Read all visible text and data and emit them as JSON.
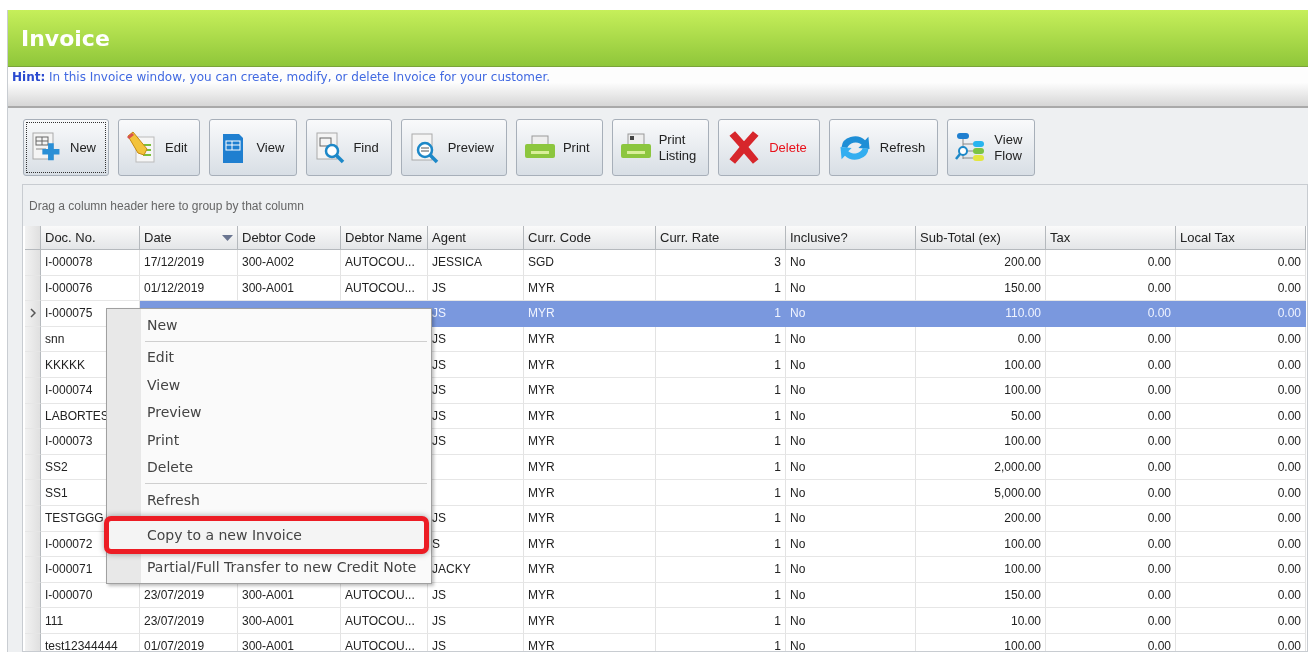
{
  "window": {
    "title": "Invoice"
  },
  "hint": "**Hint:** In this Invoice window, you can create, modify, or delete Invoice for your customer.",
  "toolbar": [
    {
      "label": "New",
      "focused": true,
      "danger": false
    },
    {
      "label": "Edit",
      "focused": false,
      "danger": false
    },
    {
      "label": "View",
      "focused": false,
      "danger": false
    },
    {
      "label": "Find",
      "focused": false,
      "danger": false
    },
    {
      "label": "Preview",
      "focused": false,
      "danger": false
    },
    {
      "label": "Print",
      "focused": false,
      "danger": false
    },
    {
      "label": "Print Listing",
      "focused": false,
      "danger": false
    },
    {
      "label": "Delete",
      "focused": false,
      "danger": true
    },
    {
      "label": "Refresh",
      "focused": false,
      "danger": false
    },
    {
      "label": "View Flow",
      "focused": false,
      "danger": false
    }
  ],
  "group_panel": "Drag a column header here to group by that column",
  "table": {
    "columns": [
      {
        "label": "Doc. No.",
        "sorted": false
      },
      {
        "label": "Date",
        "sorted": true
      },
      {
        "label": "Debtor Code",
        "sorted": false
      },
      {
        "label": "Debtor Name",
        "sorted": false
      },
      {
        "label": "Agent",
        "sorted": false
      },
      {
        "label": "Curr. Code",
        "sorted": false
      },
      {
        "label": "Curr. Rate",
        "sorted": false
      },
      {
        "label": "Inclusive?",
        "sorted": false
      },
      {
        "label": "Sub-Total (ex)",
        "sorted": false
      },
      {
        "label": "Tax",
        "sorted": false
      },
      {
        "label": "Local Tax",
        "sorted": false
      }
    ],
    "rows": [
      {
        "selected": false,
        "cells": [
          "I-000078",
          "17/12/2019",
          "300-A002",
          "AUTOCOU...",
          "JESSICA",
          "SGD",
          "3",
          "No",
          "200.00",
          "0.00",
          "0.00"
        ]
      },
      {
        "selected": false,
        "cells": [
          "I-000076",
          "01/12/2019",
          "300-A001",
          "AUTOCOU...",
          "JS",
          "MYR",
          "1",
          "No",
          "150.00",
          "0.00",
          "0.00"
        ]
      },
      {
        "selected": true,
        "cells": [
          "I-000075",
          null,
          null,
          null,
          "JS",
          "MYR",
          "1",
          "No",
          "110.00",
          "0.00",
          "0.00"
        ]
      },
      {
        "selected": false,
        "cells": [
          "snn",
          null,
          null,
          null,
          "JS",
          "MYR",
          "1",
          "No",
          "0.00",
          "0.00",
          "0.00"
        ]
      },
      {
        "selected": false,
        "cells": [
          "KKKKK",
          null,
          null,
          null,
          "JS",
          "MYR",
          "1",
          "No",
          "100.00",
          "0.00",
          "0.00"
        ]
      },
      {
        "selected": false,
        "cells": [
          "I-000074",
          null,
          null,
          null,
          "JS",
          "MYR",
          "1",
          "No",
          "100.00",
          "0.00",
          "0.00"
        ]
      },
      {
        "selected": false,
        "cells": [
          "LABORTES",
          null,
          null,
          null,
          "JS",
          "MYR",
          "1",
          "No",
          "50.00",
          "0.00",
          "0.00"
        ]
      },
      {
        "selected": false,
        "cells": [
          "I-000073",
          null,
          null,
          null,
          "JS",
          "MYR",
          "1",
          "No",
          "100.00",
          "0.00",
          "0.00"
        ]
      },
      {
        "selected": false,
        "cells": [
          "SS2",
          null,
          null,
          null,
          null,
          "MYR",
          "1",
          "No",
          "2,000.00",
          "0.00",
          "0.00"
        ]
      },
      {
        "selected": false,
        "cells": [
          "SS1",
          null,
          null,
          null,
          null,
          "MYR",
          "1",
          "No",
          "5,000.00",
          "0.00",
          "0.00"
        ]
      },
      {
        "selected": false,
        "cells": [
          "TESTGGG",
          null,
          null,
          null,
          "JS",
          "MYR",
          "1",
          "No",
          "200.00",
          "0.00",
          "0.00"
        ]
      },
      {
        "selected": false,
        "cells": [
          "I-000072",
          null,
          null,
          null,
          "S",
          "MYR",
          "1",
          "No",
          "100.00",
          "0.00",
          "0.00"
        ]
      },
      {
        "selected": false,
        "cells": [
          "I-000071",
          null,
          null,
          null,
          "JACKY",
          "MYR",
          "1",
          "No",
          "100.00",
          "0.00",
          "0.00"
        ]
      },
      {
        "selected": false,
        "cells": [
          "I-000070",
          "23/07/2019",
          "300-A001",
          "AUTOCOU...",
          "JS",
          "MYR",
          "1",
          "No",
          "150.00",
          "0.00",
          "0.00"
        ]
      },
      {
        "selected": false,
        "cells": [
          "111",
          "23/07/2019",
          "300-A001",
          "AUTOCOU...",
          "JS",
          "MYR",
          "1",
          "No",
          "10.00",
          "0.00",
          "0.00"
        ]
      },
      {
        "selected": false,
        "cells": [
          "test12344444",
          "01/07/2019",
          "300-A001",
          "AUTOCOU...",
          "JS",
          "MYR",
          "1",
          "No",
          "100.00",
          "0.00",
          "0.00"
        ]
      }
    ]
  },
  "context_menu": [
    {
      "kind": "item",
      "label": "New",
      "highlighted": false
    },
    {
      "kind": "separator"
    },
    {
      "kind": "item",
      "label": "Edit",
      "highlighted": false
    },
    {
      "kind": "item",
      "label": "View",
      "highlighted": false
    },
    {
      "kind": "item",
      "label": "Preview",
      "highlighted": false
    },
    {
      "kind": "item",
      "label": "Print",
      "highlighted": false
    },
    {
      "kind": "item",
      "label": "Delete",
      "highlighted": false
    },
    {
      "kind": "separator"
    },
    {
      "kind": "item",
      "label": "Refresh",
      "highlighted": false
    },
    {
      "kind": "item",
      "label": "Copy to a new Invoice",
      "highlighted": true
    },
    {
      "kind": "item",
      "label": "Partial/Full Transfer to new Credit Note",
      "highlighted": false
    }
  ]
}
